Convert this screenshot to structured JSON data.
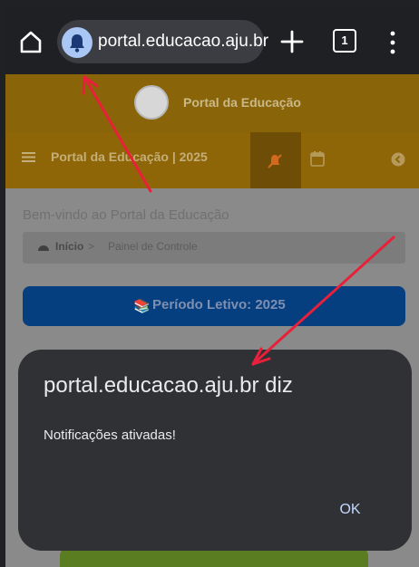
{
  "browser": {
    "url": "portal.educacao.aju.br",
    "tab_count": "1",
    "icons": {
      "home": "home-icon",
      "site_info": "bell-icon",
      "new_tab": "plus-icon",
      "tabs": "tab-switcher-icon",
      "menu": "more-vert-icon"
    }
  },
  "site": {
    "header_title": "Portal da Educação",
    "nav_title": "Portal da Educação | 2025",
    "welcome": "Bem-vindo ao Portal da Educação",
    "breadcrumb": {
      "home": "Início",
      "separator": ">",
      "current": "Painel de Controle"
    },
    "period_button": "Período Letivo: 2025",
    "period_icon": "📚"
  },
  "dialog": {
    "title": "portal.educacao.aju.br diz",
    "message": "Notificações ativadas!",
    "ok_label": "OK"
  },
  "colors": {
    "browser_bar": "#1f2023",
    "dialog_bg": "#303134",
    "arrow": "#e8203a",
    "header_orange_dimmed": "#8a6408",
    "period_blue_dimmed": "#063f80"
  }
}
